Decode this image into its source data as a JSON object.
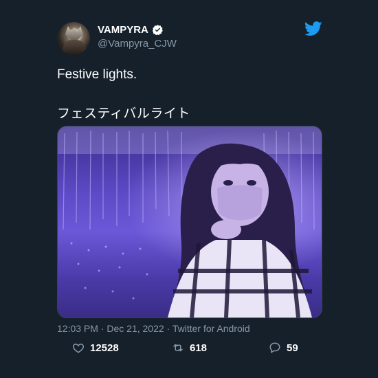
{
  "author": {
    "display_name": "VAMPYRA",
    "handle": "@Vampyra_CJW",
    "verified": true
  },
  "tweet": {
    "lines": [
      "Festive lights.",
      "フェスティバルライト"
    ],
    "timestamp": "12:03 PM · Dec 21, 2022 · Twitter for Android"
  },
  "stats": {
    "likes": "12528",
    "retweets": "618",
    "replies": "59"
  },
  "icons": {
    "brand": "twitter-bird-icon",
    "like": "heart-icon",
    "retweet": "retweet-icon",
    "reply": "reply-icon",
    "verified": "verified-badge-icon"
  },
  "colors": {
    "background": "#15202b",
    "brand": "#1d9bf0",
    "secondary_text": "#8899a6"
  }
}
